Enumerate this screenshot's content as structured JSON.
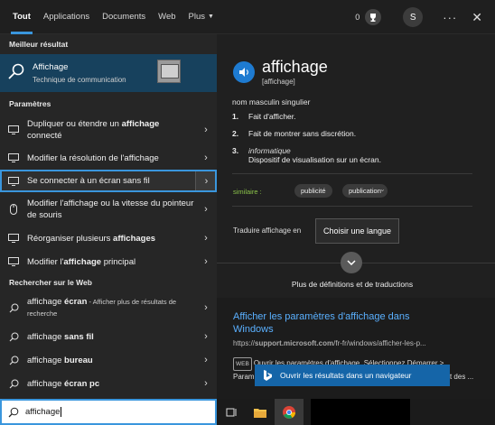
{
  "tabs": [
    {
      "label": "Tout"
    },
    {
      "label": "Applications"
    },
    {
      "label": "Documents"
    },
    {
      "label": "Web"
    },
    {
      "label": "Plus"
    }
  ],
  "header": {
    "points": "0",
    "avatar_initial": "S",
    "more": "···",
    "close": "✕"
  },
  "left": {
    "best_header": "Meilleur résultat",
    "best": {
      "title": "Affichage",
      "subtitle": "Technique de communication"
    },
    "settings_header": "Paramètres",
    "settings": [
      {
        "pre": "Dupliquer ou étendre un ",
        "bold": "affichage",
        "post": " connecté"
      },
      {
        "pre": "Modifier la résolution de l'affichage",
        "bold": "",
        "post": ""
      },
      {
        "pre": "Se connecter à un écran sans fil",
        "bold": "",
        "post": ""
      },
      {
        "pre": "Modifier l'affichage ou la vitesse du pointeur de souris",
        "bold": "",
        "post": ""
      },
      {
        "pre": "Réorganiser plusieurs ",
        "bold": "affichages",
        "post": ""
      },
      {
        "pre": "Modifier l'",
        "bold": "affichage",
        "post": " principal"
      }
    ],
    "web_header": "Rechercher sur le Web",
    "web": [
      {
        "pre": "affichage ",
        "bold": "écran",
        "small": " - Afficher plus de résultats de recherche"
      },
      {
        "pre": "affichage ",
        "bold": "sans fil",
        "small": ""
      },
      {
        "pre": "affichage ",
        "bold": "bureau",
        "small": ""
      },
      {
        "pre": "affichage ",
        "bold": "écran pc",
        "small": ""
      }
    ]
  },
  "search": {
    "value": "affichage"
  },
  "right": {
    "word": "affichage",
    "phonetic": "[affichage]",
    "pos": "nom masculin singulier",
    "defs": [
      {
        "n": "1.",
        "text": "Fait d'afficher."
      },
      {
        "n": "2.",
        "text": "Fait de montrer sans discrétion."
      },
      {
        "n": "3.",
        "label": "informatique",
        "text": "Dispositif de visualisation sur un écran."
      }
    ],
    "syn_label": "similaire :",
    "synonyms": [
      "publicité",
      "publication"
    ],
    "translate_label": "Traduire affichage en",
    "translate_button": "Choisir une langue",
    "more_defs": "Plus de définitions et de traductions",
    "web_result": {
      "title": "Afficher les paramètres d'affichage dans Windows",
      "url_pre": "https://",
      "url_domain": "support.microsoft.com",
      "url_post": "/fr-fr/windows/afficher-les-p...",
      "tag": "WEB",
      "snippet": "Ouvrir les paramètres d'affichage. Sélectionnez Démarrer > Paramètres > Système > Affichage. Pour modifier la taille du texte et des ..."
    },
    "open_browser": "Ouvrir les résultats dans un navigateur"
  },
  "colors": {
    "accent": "#3a96dd",
    "best_bg": "#17415d",
    "link": "#5ab0ff"
  }
}
